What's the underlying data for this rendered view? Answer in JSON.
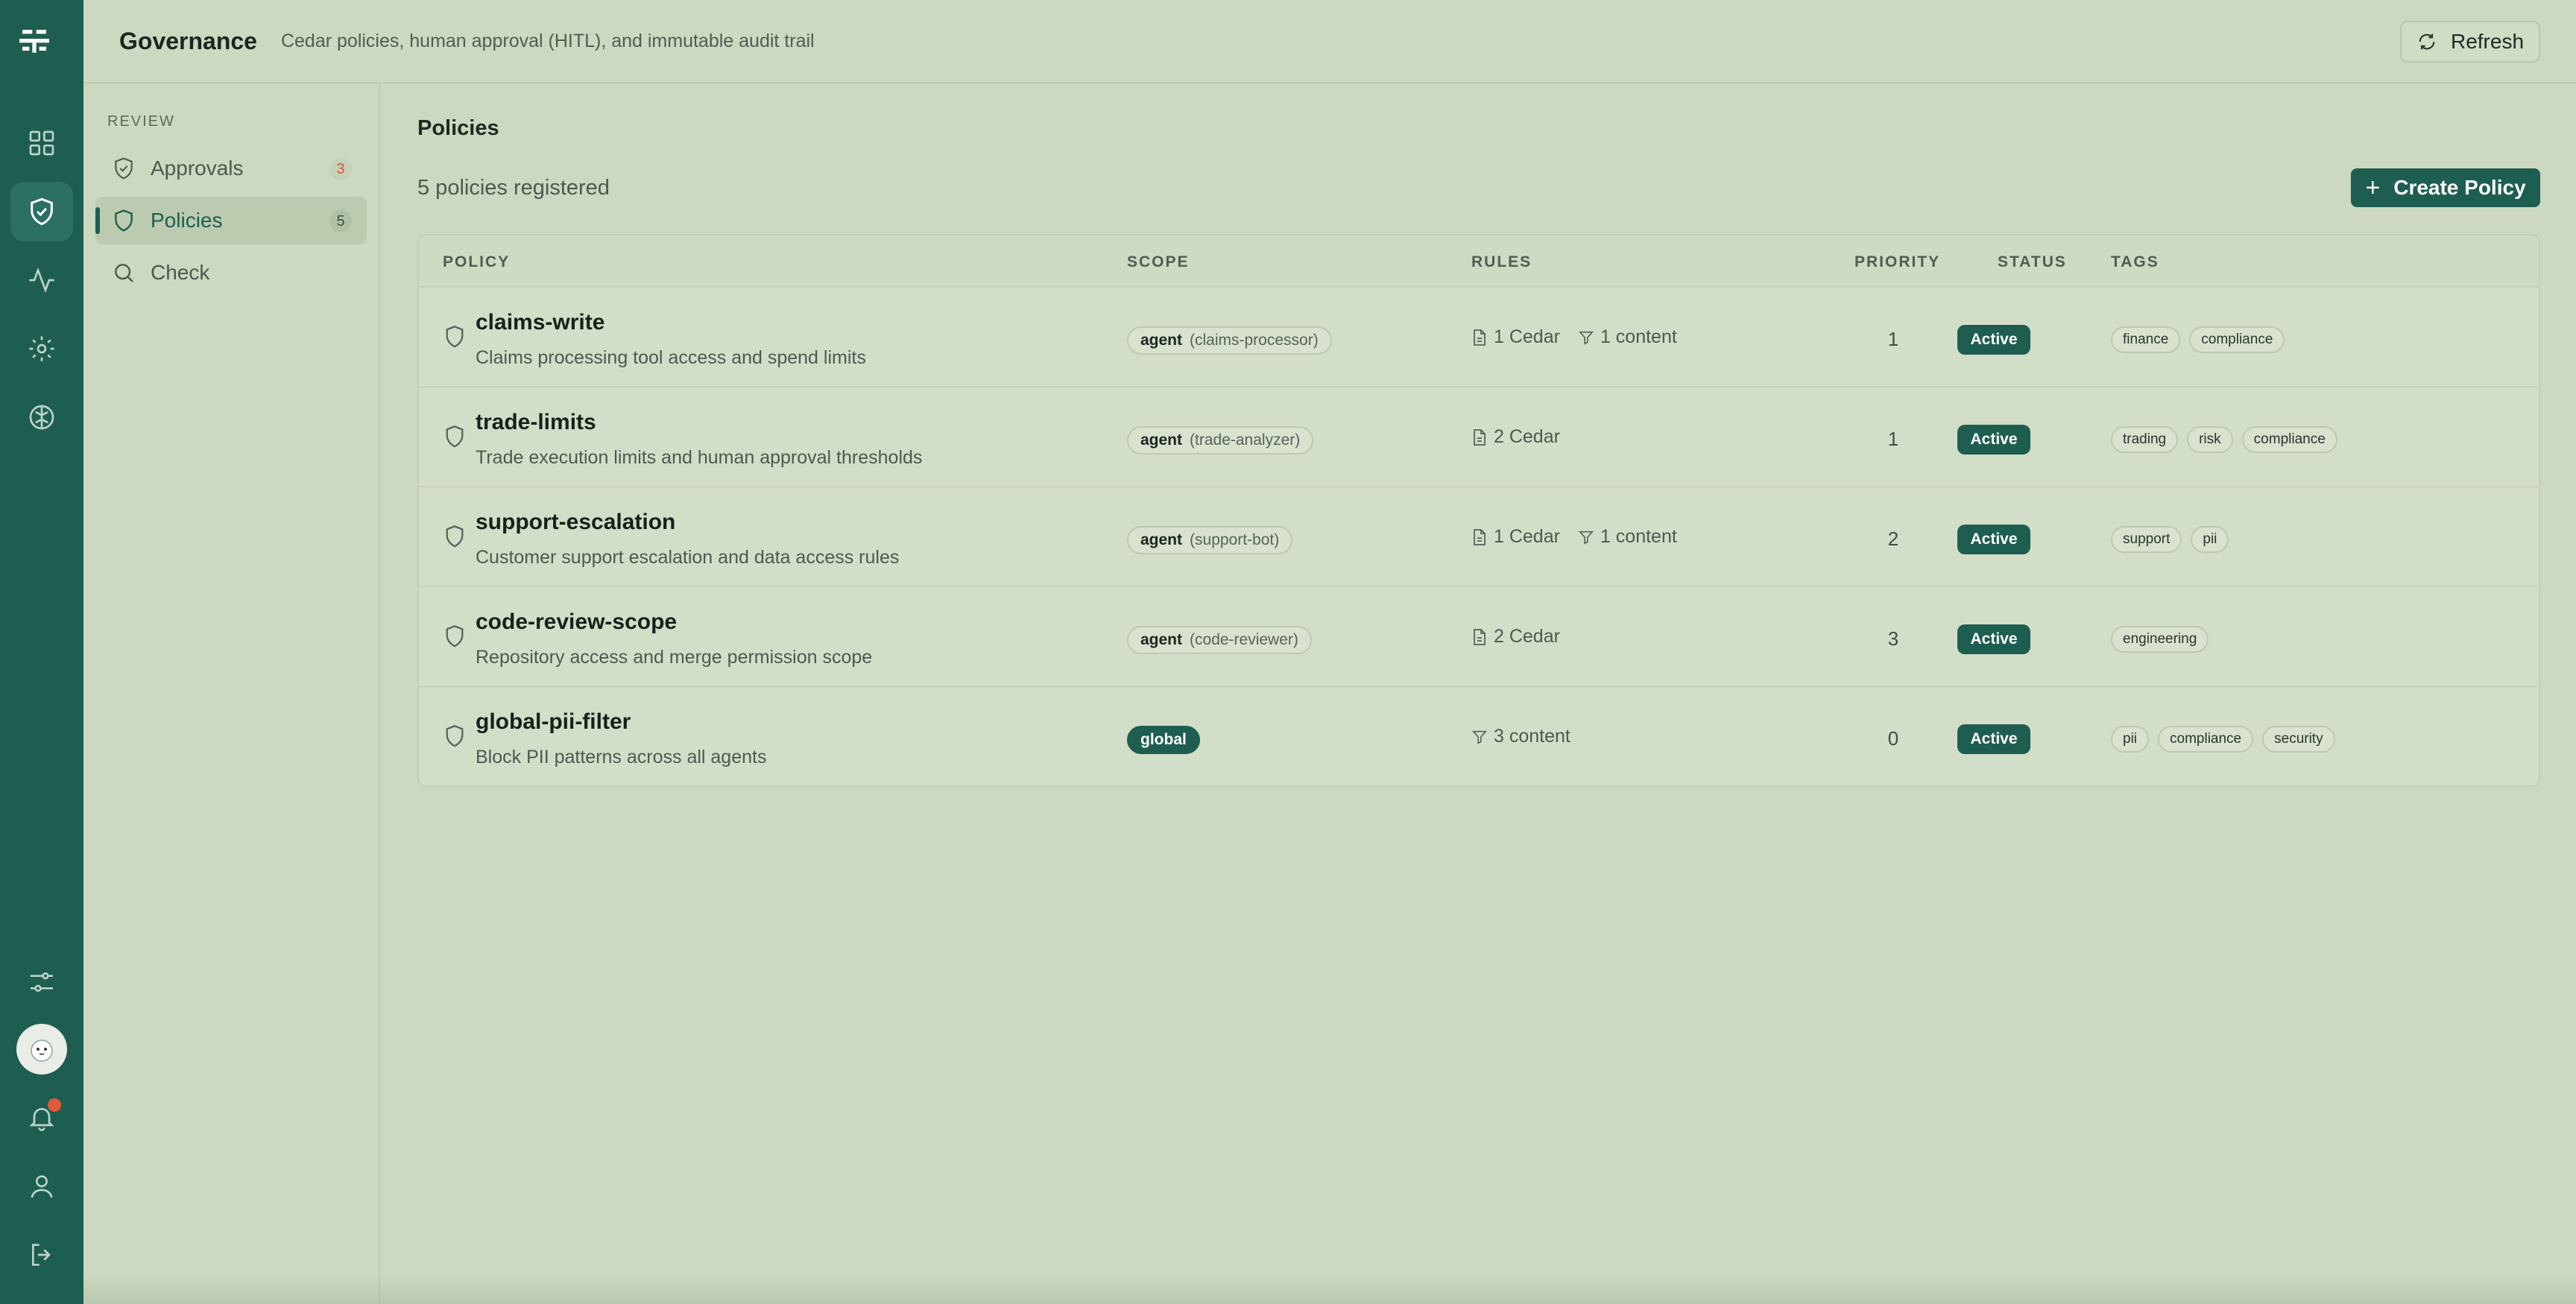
{
  "header": {
    "title": "Governance",
    "subtitle": "Cedar policies, human approval (HITL), and immutable audit trail",
    "refresh_label": "Refresh"
  },
  "rail": {
    "icons": [
      "logo-icon",
      "dashboard-icon",
      "shield-check-icon",
      "activity-icon",
      "settings-icon",
      "brain-icon",
      "sliders-icon",
      "avatar",
      "bell-icon",
      "user-icon",
      "logout-icon"
    ]
  },
  "subnav": {
    "section": "REVIEW",
    "items": [
      {
        "label": "Approvals",
        "count": "3"
      },
      {
        "label": "Policies",
        "count": "5"
      },
      {
        "label": "Check",
        "count": ""
      }
    ]
  },
  "main": {
    "title": "Policies",
    "count_text": "5 policies registered",
    "create_label": "Create Policy",
    "columns": [
      "POLICY",
      "SCOPE",
      "RULES",
      "PRIORITY",
      "STATUS",
      "TAGS"
    ],
    "rows": [
      {
        "name": "claims-write",
        "desc": "Claims processing tool access and spend limits",
        "scope_kind": "agent",
        "scope_value": "(claims-processor)",
        "cedar": "1 Cedar",
        "content": "1 content",
        "priority": "1",
        "status": "Active",
        "tags": [
          "finance",
          "compliance"
        ]
      },
      {
        "name": "trade-limits",
        "desc": "Trade execution limits and human approval thresholds",
        "scope_kind": "agent",
        "scope_value": "(trade-analyzer)",
        "cedar": "2 Cedar",
        "content": "",
        "priority": "1",
        "status": "Active",
        "tags": [
          "trading",
          "risk",
          "compliance"
        ]
      },
      {
        "name": "support-escalation",
        "desc": "Customer support escalation and data access rules",
        "scope_kind": "agent",
        "scope_value": "(support-bot)",
        "cedar": "1 Cedar",
        "content": "1 content",
        "priority": "2",
        "status": "Active",
        "tags": [
          "support",
          "pii"
        ]
      },
      {
        "name": "code-review-scope",
        "desc": "Repository access and merge permission scope",
        "scope_kind": "agent",
        "scope_value": "(code-reviewer)",
        "cedar": "2 Cedar",
        "content": "",
        "priority": "3",
        "status": "Active",
        "tags": [
          "engineering"
        ]
      },
      {
        "name": "global-pii-filter",
        "desc": "Block PII patterns across all agents",
        "scope_kind": "global",
        "scope_value": "",
        "cedar": "",
        "content": "3 content",
        "priority": "0",
        "status": "Active",
        "tags": [
          "pii",
          "compliance",
          "security"
        ]
      }
    ]
  },
  "colors": {
    "accent": "#1e5e50",
    "background": "#ccd8bf",
    "warn": "#d9573a"
  }
}
